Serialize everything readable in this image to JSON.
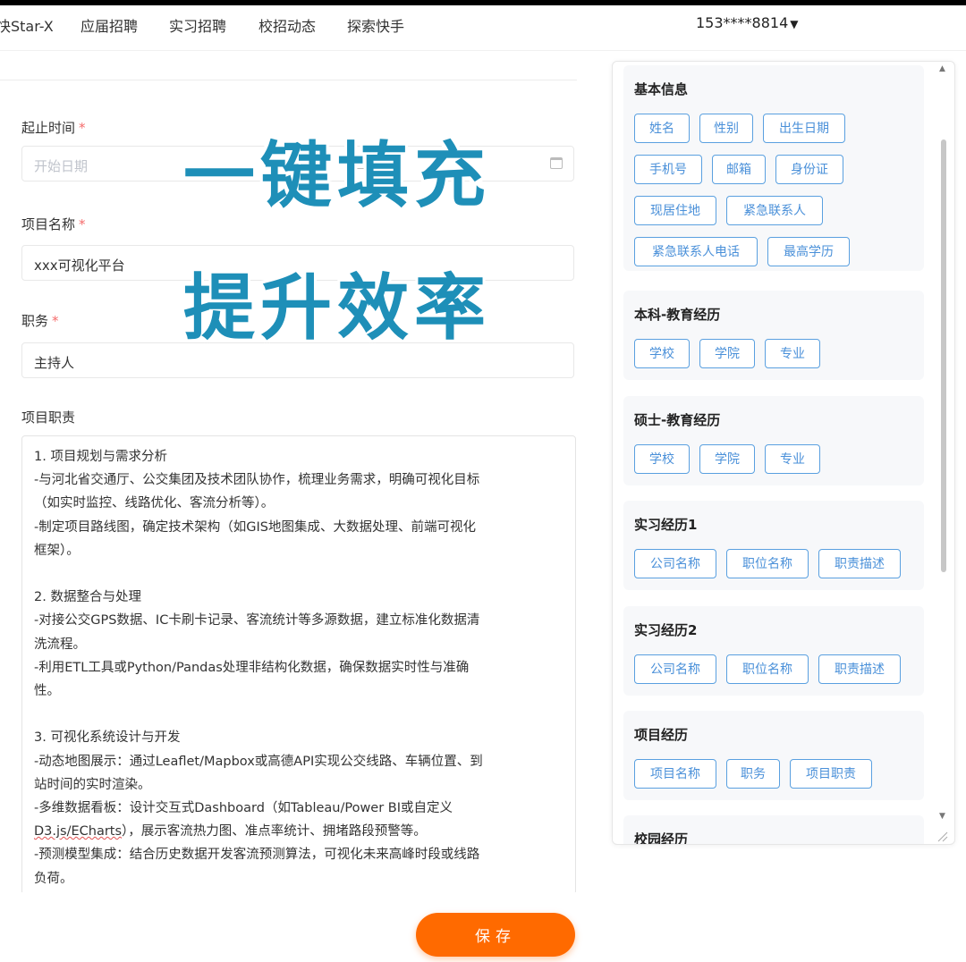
{
  "nav": {
    "items": [
      "快Star-X",
      "应届招聘",
      "实习招聘",
      "校招动态",
      "探索快手"
    ],
    "account": "153****8814"
  },
  "form": {
    "date_label": "起止时间",
    "date_placeholder": "开始日期",
    "project_label": "项目名称",
    "project_value": "xxx可视化平台",
    "role_label": "职务",
    "role_value": "主持人",
    "duties_label": "项目职责",
    "duties_lines": [
      "1. 项目规划与需求分析",
      "  -与河北省交通厅、公交集团及技术团队协作，梳理业务需求，明确可视化目标",
      "（如实时监控、线路优化、客流分析等）。",
      "  -制定项目路线图，确定技术架构（如GIS地图集成、大数据处理、前端可视化",
      "框架）。",
      "",
      "2. 数据整合与处理",
      "  -对接公交GPS数据、IC卡刷卡记录、客流统计等多源数据，建立标准化数据清",
      "洗流程。",
      "  -利用ETL工具或Python/Pandas处理非结构化数据，确保数据实时性与准确",
      "性。",
      "",
      "3. 可视化系统设计与开发",
      "  -动态地图展示：通过Leaflet/Mapbox或高德API实现公交线路、车辆位置、到",
      "站时间的实时渲染。",
      "  -多维数据看板：设计交互式Dashboard（如Tableau/Power BI或自定义",
      "D3.js/ECharts），展示客流热力图、准点率统计、拥堵路段预警等。",
      "  -预测模型集成：结合历史数据开发客流预测算法，可视化未来高峰时段或线路",
      "负荷。"
    ],
    "save_label": "保存"
  },
  "overlay": {
    "line1": "一键填充",
    "line2": "提升效率"
  },
  "panel": {
    "sections": [
      {
        "title": "基本信息",
        "tags": [
          "姓名",
          "性别",
          "出生日期",
          "手机号",
          "邮箱",
          "身份证",
          "现居住地",
          "紧急联系人",
          "紧急联系人电话",
          "最高学历"
        ]
      },
      {
        "title": "本科-教育经历",
        "tags": [
          "学校",
          "学院",
          "专业"
        ]
      },
      {
        "title": "硕士-教育经历",
        "tags": [
          "学校",
          "学院",
          "专业"
        ]
      },
      {
        "title": "实习经历1",
        "tags": [
          "公司名称",
          "职位名称",
          "职责描述"
        ]
      },
      {
        "title": "实习经历2",
        "tags": [
          "公司名称",
          "职位名称",
          "职责描述"
        ]
      },
      {
        "title": "项目经历",
        "tags": [
          "项目名称",
          "职务",
          "项目职责"
        ]
      },
      {
        "title": "校园经历",
        "tags": []
      }
    ]
  },
  "colors": {
    "accent_orange": "#ff6a00",
    "tag_blue": "#4a90d9",
    "overlay_blue": "#1e8fb8",
    "required_red": "#f56c6c"
  }
}
